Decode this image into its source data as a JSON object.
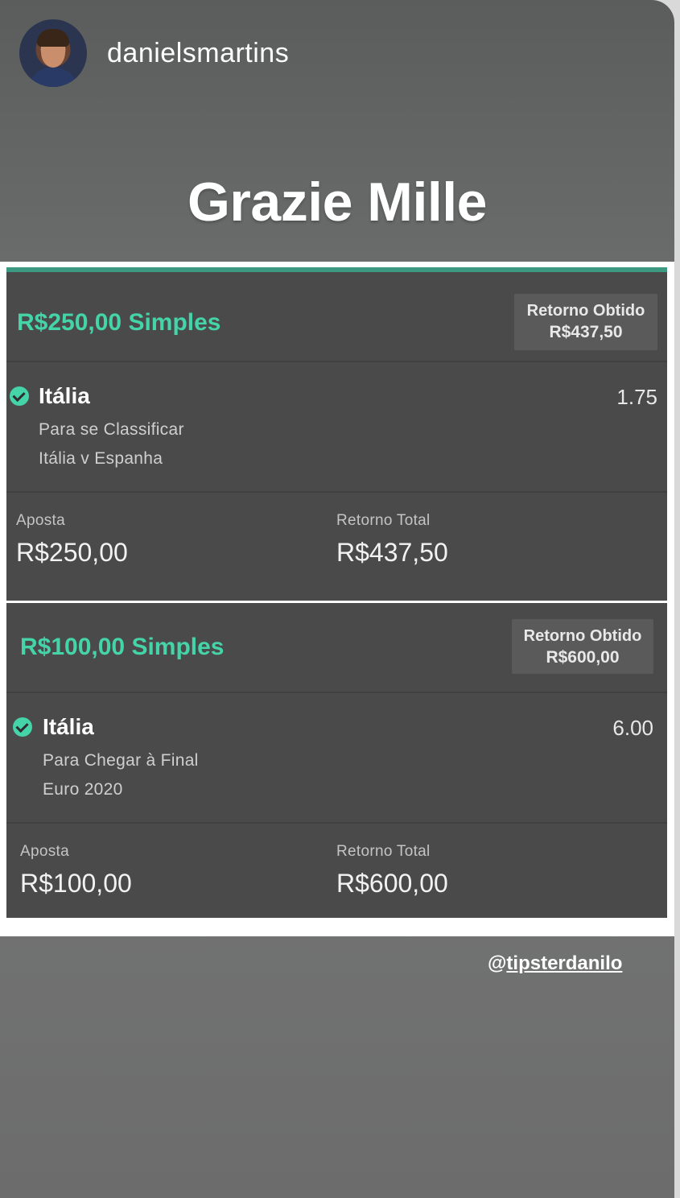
{
  "header": {
    "username": "danielsmartins"
  },
  "headline": "Grazie Mille",
  "bets": [
    {
      "title": "R$250,00 Simples",
      "return_label": "Retorno Obtido",
      "return_value": "R$437,50",
      "selection": "Itália",
      "odds": "1.75",
      "market": "Para se Classificar",
      "event": "Itália v Espanha",
      "stake_label": "Aposta",
      "stake_value": "R$250,00",
      "total_label": "Retorno Total",
      "total_value": "R$437,50"
    },
    {
      "title": "R$100,00 Simples",
      "return_label": "Retorno Obtido",
      "return_value": "R$600,00",
      "selection": "Itália",
      "odds": "6.00",
      "market": "Para Chegar à Final",
      "event": "Euro 2020",
      "stake_label": "Aposta",
      "stake_value": "R$100,00",
      "total_label": "Retorno Total",
      "total_value": "R$600,00"
    }
  ],
  "mention": {
    "at": "@",
    "handle": "tipsterdanilo"
  },
  "colors": {
    "accent": "#45d3a8",
    "card": "#4a4a4a",
    "frame": "#ffffff"
  }
}
